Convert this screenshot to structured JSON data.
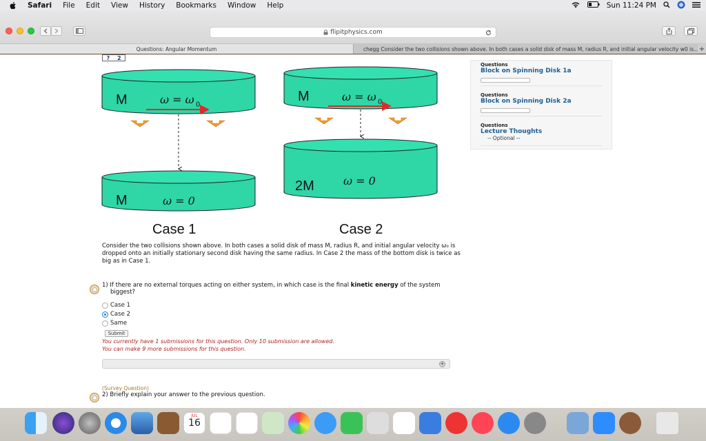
{
  "menubar": {
    "app": "Safari",
    "items": [
      "File",
      "Edit",
      "View",
      "History",
      "Bookmarks",
      "Window",
      "Help"
    ],
    "clock": "Sun 11:24 PM"
  },
  "browser": {
    "address": "flipitphysics.com",
    "tabs": [
      {
        "label": "Questions: Angular Momentum"
      },
      {
        "label": "chegg Consider the two collisions shown above. In both cases a solid disk of mass M, radius R, and initial angular velocity w0 is..."
      }
    ]
  },
  "page": {
    "pager": [
      "?",
      "2"
    ],
    "figure": {
      "disk_labels": {
        "top_left_mass": "M",
        "top_left_omega": "ω = ω",
        "top_left_omega_sub": "0",
        "top_right_mass": "M",
        "top_right_omega": "ω = ω",
        "top_right_omega_sub": "0",
        "bottom_left_mass": "M",
        "bottom_left_omega": "ω = 0",
        "bottom_right_mass": "2M",
        "bottom_right_omega": "ω = 0"
      },
      "case1": "Case 1",
      "case2": "Case 2"
    },
    "description": [
      "Consider the two collisions shown above. In both cases a solid disk of mass M, radius R, and initial angular velocity ω₀ is",
      "dropped onto an initially stationary second disk having the same radius. In Case 2 the mass of the bottom disk is twice as",
      "big as in Case 1."
    ],
    "question1": {
      "text_before": "1) If there are no external torques acting on either system, in which case is the final",
      "text_bold": "kinetic energy",
      "text_after": "of the system",
      "text_line2": "biggest?",
      "options": [
        "Case 1",
        "Case 2",
        "Same"
      ],
      "selected_index": 1,
      "submit_label": "Submit",
      "warning1": "You currently have 1 submissions for this question. Only 10 submission are allowed.",
      "warning2": "You can make 9 more submissions for this question."
    },
    "question2": {
      "tag": "(Survey Question)",
      "text": "2) Briefly explain your answer to the previous question."
    }
  },
  "sidebar": {
    "items": [
      {
        "category": "Questions",
        "title": "Block on Spinning Disk 1a",
        "has_progress": true
      },
      {
        "category": "Questions",
        "title": "Block on Spinning Disk 2a",
        "has_progress": true
      },
      {
        "category": "Questions",
        "title": "Lecture Thoughts",
        "subtitle": "-- Optional --",
        "has_progress": false
      }
    ]
  },
  "dock": {
    "calendar_month": "JUL",
    "calendar_day": "16"
  },
  "colors": {
    "disk_fill": "#2fd6a6",
    "disk_top": "#32dcae",
    "arrow_red": "#e02a2a",
    "orange_arrow": "#f29a2e",
    "link_blue": "#1b5e96",
    "warning_red": "#b01e1e"
  }
}
